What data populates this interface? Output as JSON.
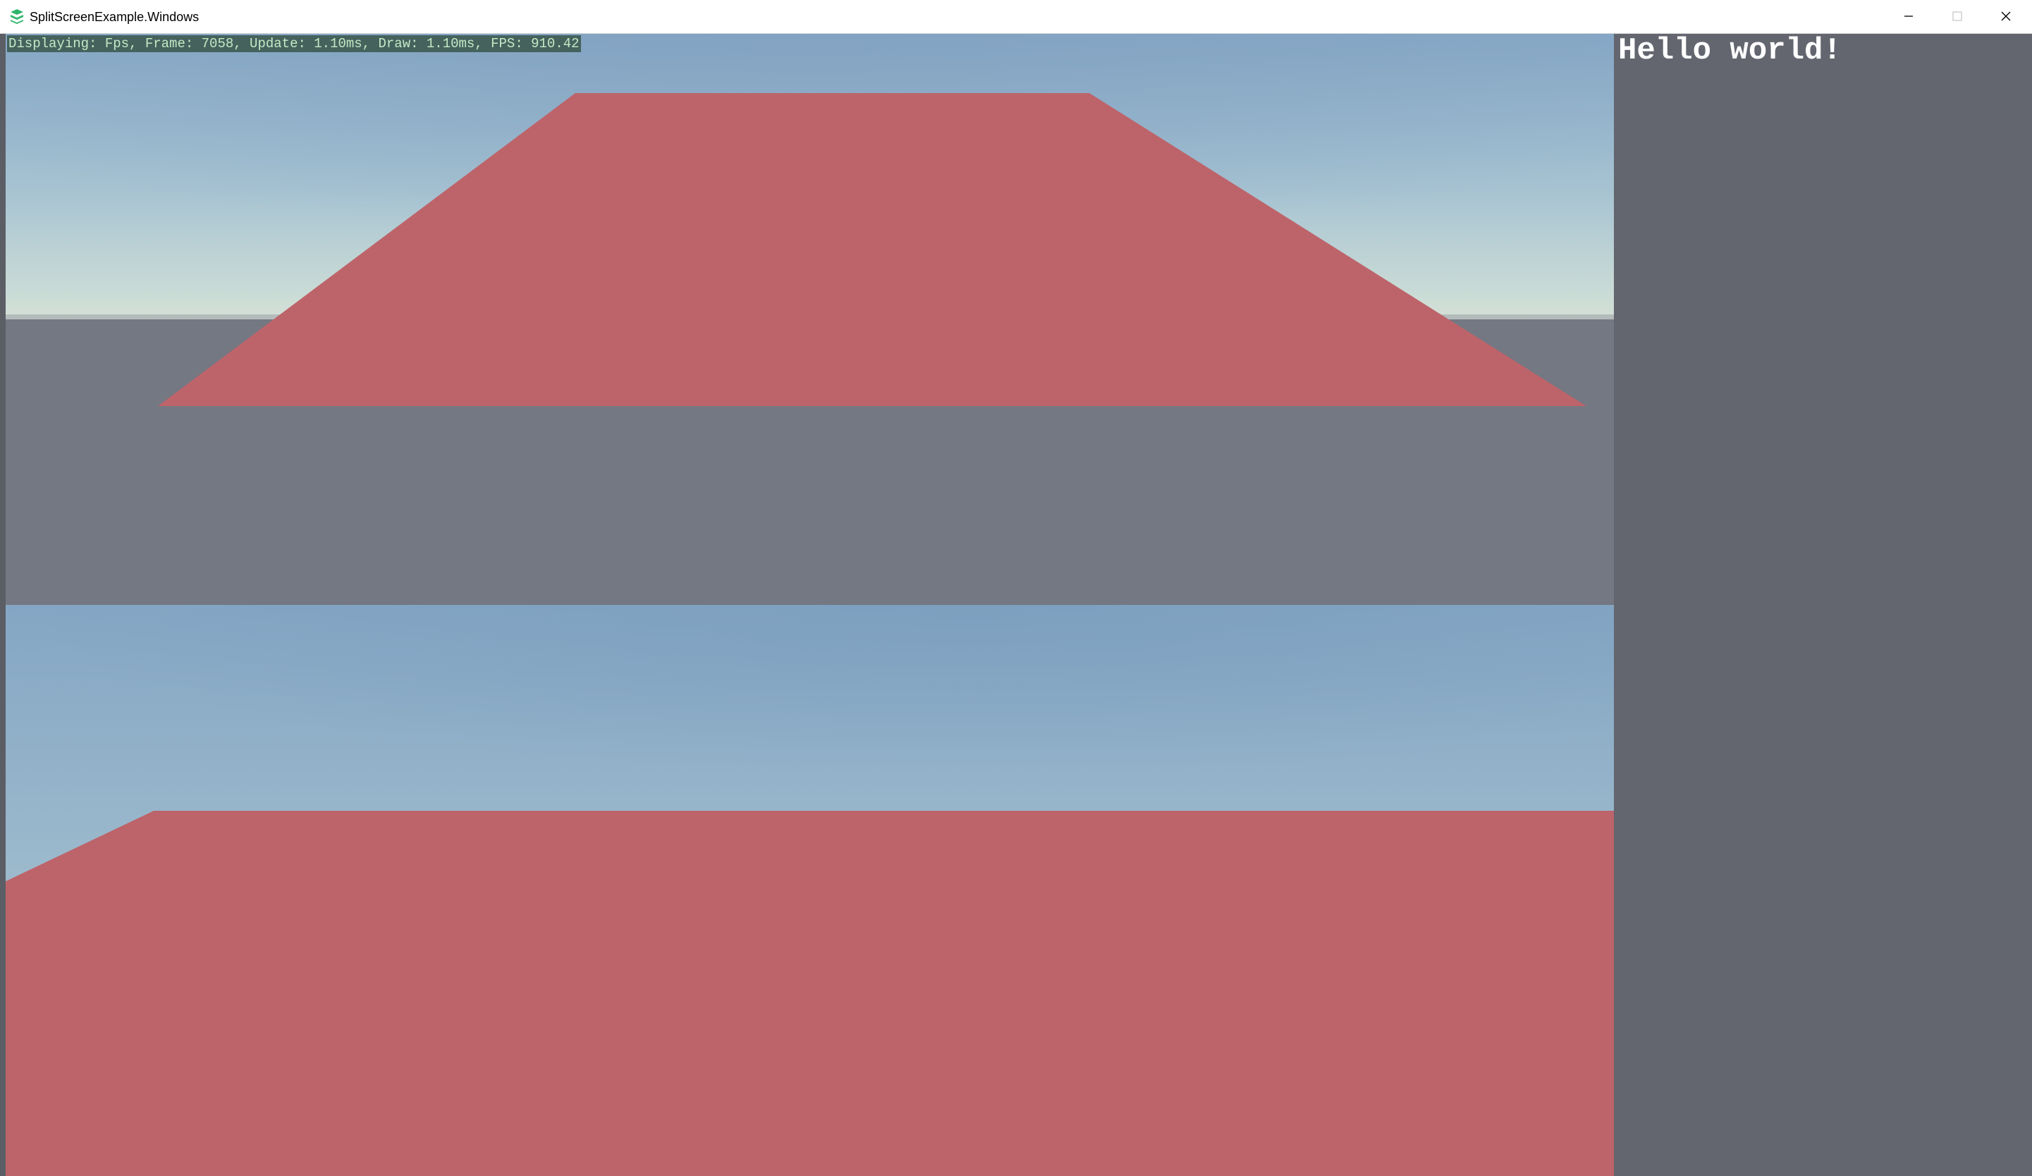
{
  "window": {
    "title": "SplitScreenExample.Windows",
    "app_icon": "stacked-layers-icon",
    "controls": {
      "minimize_icon": "minimize-icon",
      "maximize_icon": "maximize-icon",
      "close_icon": "close-icon"
    }
  },
  "overlay": {
    "fps_text": "Displaying: Fps, Frame: 7058, Update: 1.10ms, Draw: 1.10ms, FPS: 910.42"
  },
  "side_panel": {
    "text": "Hello world!"
  },
  "colors": {
    "sky_top": "#7fa3c2",
    "sky_horizon": "#c8d9d6",
    "ground": "#747883",
    "plane": "#bd646a",
    "panel": "#64666f",
    "fps_bg": "#415d55",
    "fps_text": "#c9f0c5"
  }
}
